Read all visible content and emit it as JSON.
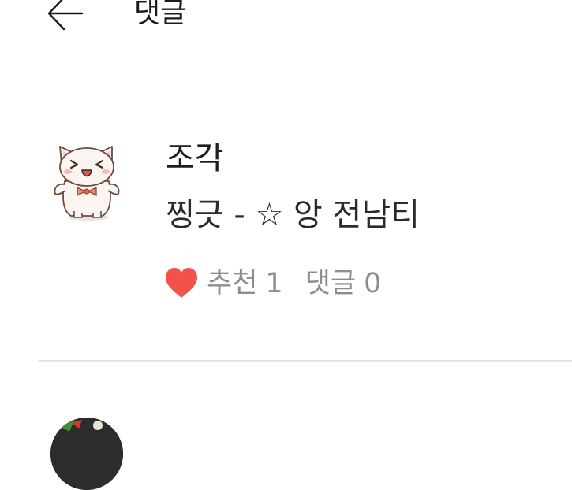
{
  "header": {
    "title": "댓글",
    "back_icon": "arrow-left-icon"
  },
  "comment": {
    "author": "조각",
    "text": "찡긋 - ☆ 앙 전남티",
    "avatar_icon": "cat-avatar",
    "like_icon": "heart-icon",
    "like_label": "추천",
    "like_count": "1",
    "reply_label": "댓글",
    "reply_count": "0"
  },
  "colors": {
    "heart": "#f2524a",
    "meta_text": "#8d8d8d",
    "divider": "#e3e8e4"
  }
}
